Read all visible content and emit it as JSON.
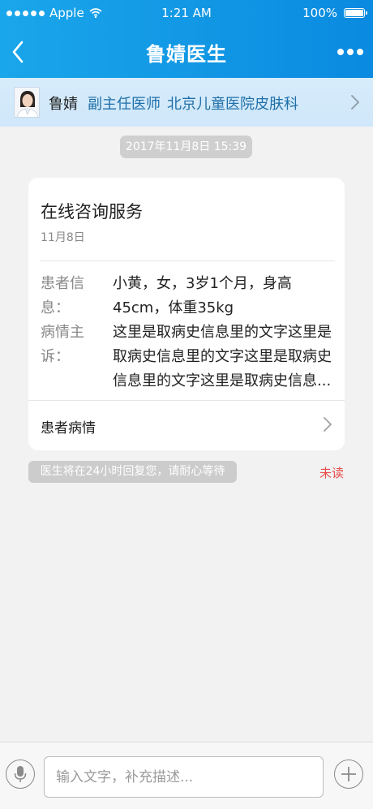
{
  "status_bar": {
    "carrier": "Apple",
    "time": "1:21 AM",
    "battery": "100%",
    "battery_level": 1.0
  },
  "nav": {
    "title": "鲁婧医生",
    "back_icon": "chevron-left-icon",
    "more_icon": "more-dots-icon"
  },
  "doctor": {
    "name": "鲁婧",
    "title": "副主任医师",
    "hospital": "北京儿童医院皮肤科"
  },
  "chat": {
    "timestamp": "2017年11月8日 15:39",
    "card": {
      "title": "在线咨询服务",
      "date": "11月8日",
      "patient_info_label": "患者信息：",
      "patient_info_value": "小黄，女，3岁1个月，身高45cm，体重35kg",
      "complaint_label": "病情主诉：",
      "complaint_value": "这里是取病史信息里的文字这里是取病史信息里的文字这里是取病史信息里的文字这里是取病史信息...",
      "condition_label": "患者病情"
    },
    "notice": "医生将在24小时回复您，请耐心等待",
    "unread": "未读"
  },
  "input_bar": {
    "placeholder": "输入文字，补充描述..."
  },
  "colors": {
    "brand": "#0a8ae0",
    "doctor_link": "#1f6fa8",
    "unread": "#e84a4a"
  }
}
